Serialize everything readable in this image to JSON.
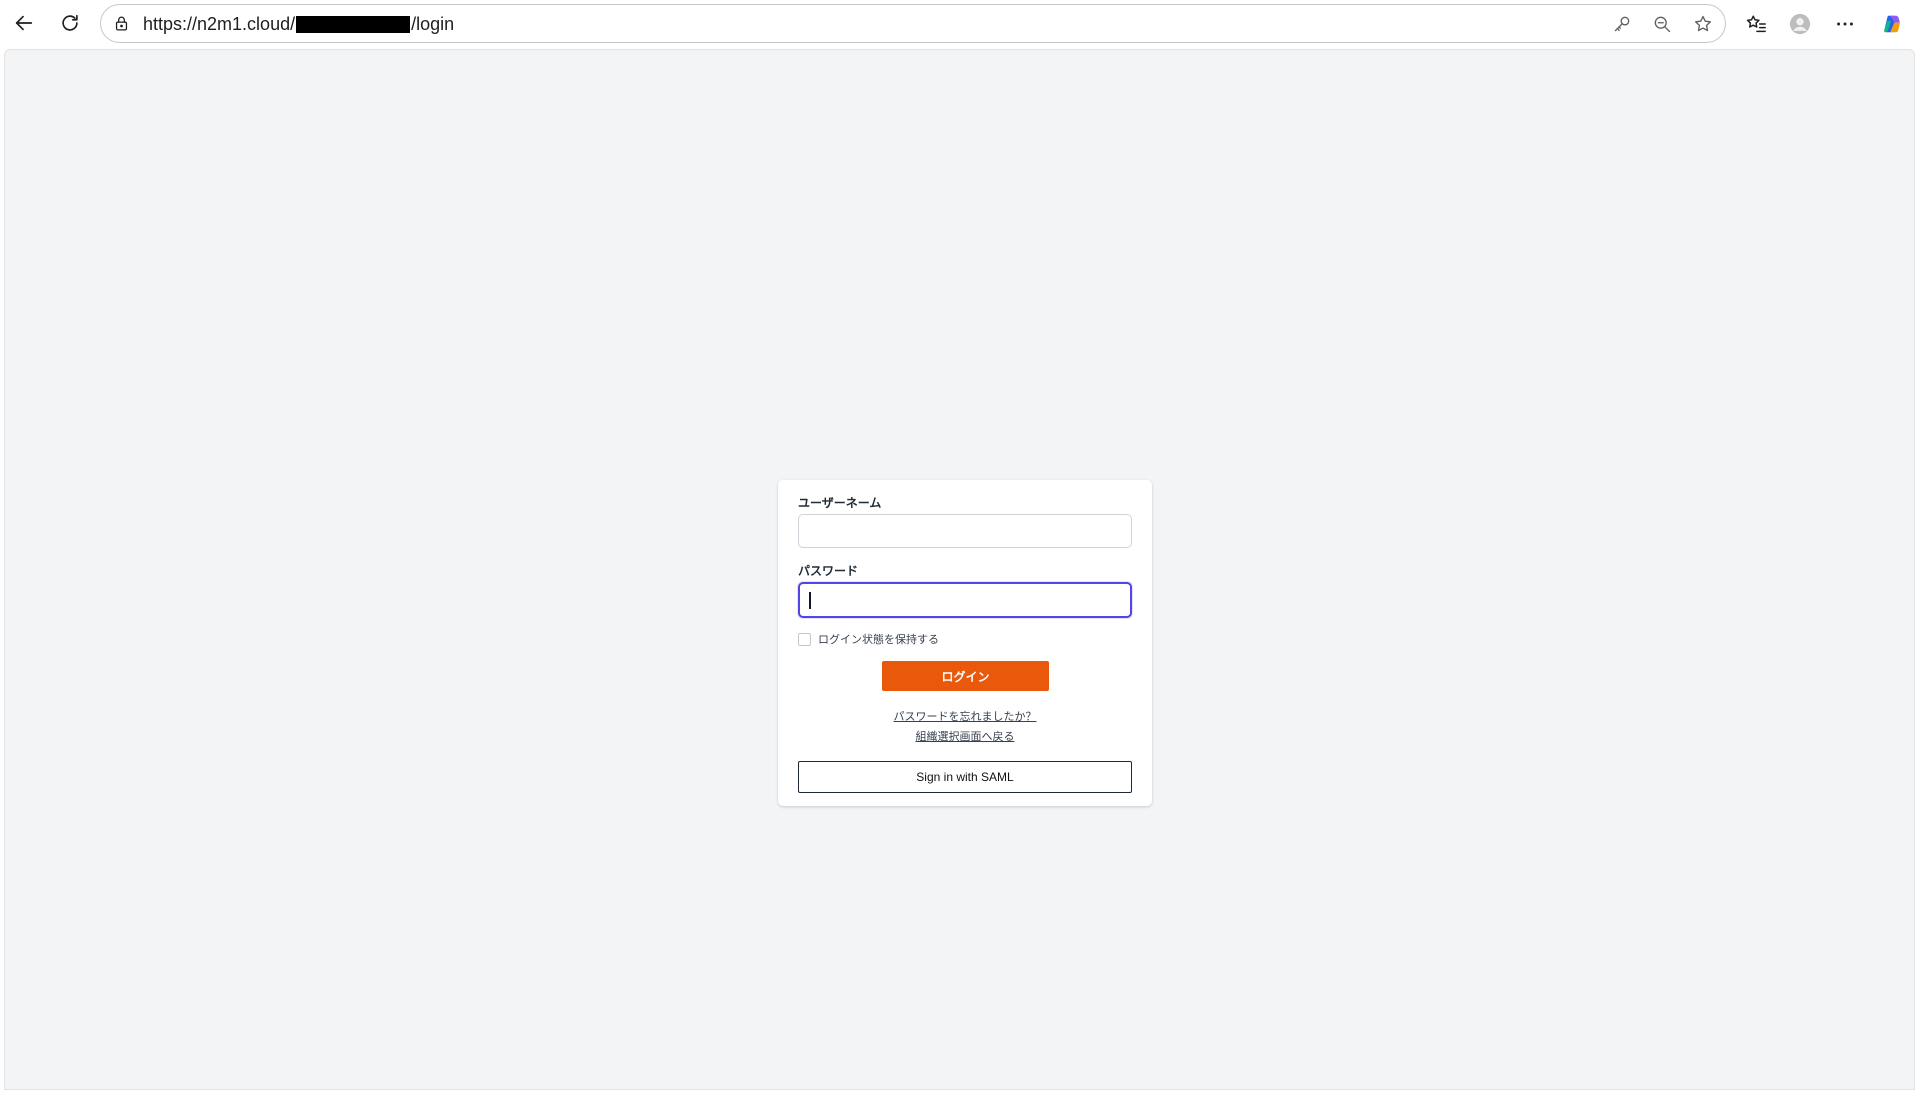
{
  "browser": {
    "url_prefix": "https://n2m1.cloud/",
    "url_suffix": "/login",
    "icons": {
      "back": "back-arrow-icon",
      "reload": "reload-icon",
      "lock": "lock-icon",
      "key": "key-icon",
      "zoom": "zoom-out-icon",
      "favorite": "star-icon",
      "favorites_list": "favorites-icon",
      "profile": "profile-icon",
      "more": "more-icon",
      "copilot": "copilot-icon"
    }
  },
  "login": {
    "username_label": "ユーザーネーム",
    "username_value": "",
    "password_label": "パスワード",
    "password_value": "",
    "remember_label": "ログイン状態を保持する",
    "remember_checked": false,
    "login_button": "ログイン",
    "forgot_password_link": "パスワードを忘れましたか？",
    "back_to_org_link": "組織選択画面へ戻る",
    "saml_button": "Sign in with SAML"
  },
  "colors": {
    "page_background": "#f3f4f6",
    "card_background": "#ffffff",
    "primary_button": "#ea580c",
    "focus_ring": "#4f46e5"
  }
}
